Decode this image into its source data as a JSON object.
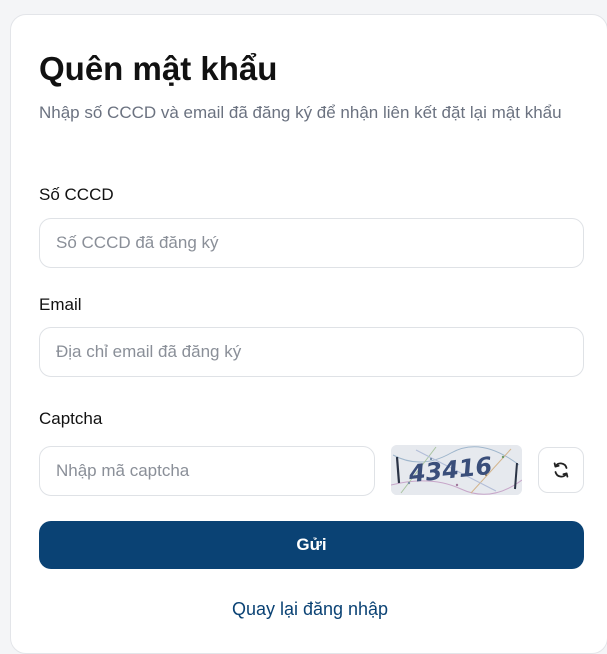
{
  "page": {
    "title": "Quên mật khẩu",
    "subtitle": "Nhập số CCCD và email đã đăng ký để nhận liên kết đặt lại mật khẩu"
  },
  "form": {
    "cccd": {
      "label": "Số CCCD",
      "placeholder": "Số CCCD đã đăng ký",
      "value": ""
    },
    "email": {
      "label": "Email",
      "placeholder": "Địa chỉ email đã đăng ký",
      "value": ""
    },
    "captcha": {
      "label": "Captcha",
      "placeholder": "Nhập mã captcha",
      "value": "",
      "image_text": "43416",
      "refresh_icon": "refresh-icon"
    },
    "submit_label": "Gửi",
    "back_link": "Quay lại đăng nhập"
  },
  "colors": {
    "primary": "#0a4274",
    "title": "#111111",
    "muted": "#6b7280",
    "border": "#dfe2e6"
  }
}
